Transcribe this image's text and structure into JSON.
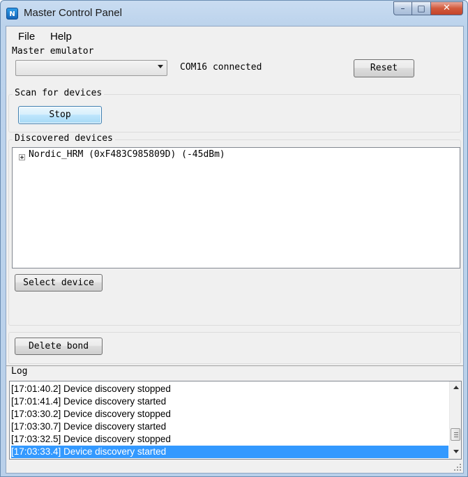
{
  "window": {
    "title": "Master Control Panel",
    "icon": "app-logo-icon",
    "icon_glyph": "N",
    "controls": {
      "minimize": "–",
      "maximize": "□",
      "close": "✕"
    }
  },
  "menu": {
    "items": [
      "File",
      "Help"
    ]
  },
  "master_emulator": {
    "label": "Master emulator",
    "combo_value": "",
    "status": "COM16 connected",
    "reset_label": "Reset"
  },
  "scan": {
    "label": "Scan for devices",
    "stop_label": "Stop"
  },
  "discovered": {
    "label": "Discovered devices",
    "devices": [
      "Nordic_HRM (0xF483C985809D) (-45dBm)"
    ],
    "select_label": "Select device"
  },
  "bond": {
    "delete_label": "Delete bond"
  },
  "log": {
    "label": "Log",
    "lines": [
      "[17:01:40.2] Device discovery stopped",
      "[17:01:41.4] Device discovery started",
      "[17:03:30.2] Device discovery stopped",
      "[17:03:30.7] Device discovery started",
      "[17:03:32.5] Device discovery stopped",
      "[17:03:33.4] Device discovery started"
    ],
    "selected_index": 5
  },
  "colors": {
    "selection": "#3399ff",
    "close_button": "#c4442a",
    "titlebar": "#bcd3ec"
  }
}
